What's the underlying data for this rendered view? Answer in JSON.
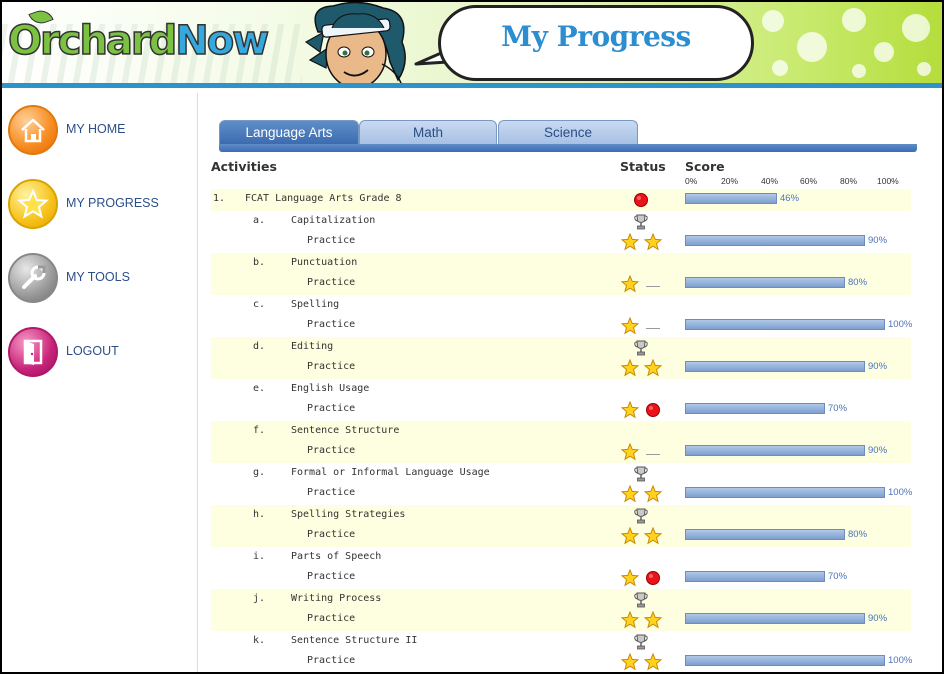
{
  "header": {
    "logo_part1": "Orchard",
    "logo_part2": "Now",
    "page_title": "My Progress"
  },
  "sidebar": {
    "items": [
      {
        "label": "MY HOME",
        "icon": "home-icon",
        "color": "#f78a1d"
      },
      {
        "label": "MY PROGRESS",
        "icon": "star-icon",
        "color": "#f6c21a"
      },
      {
        "label": "MY TOOLS",
        "icon": "wrench-icon",
        "color": "#9a9a9a"
      },
      {
        "label": "LOGOUT",
        "icon": "door-icon",
        "color": "#c8237a"
      }
    ]
  },
  "tabs": [
    {
      "label": "Language Arts",
      "active": true
    },
    {
      "label": "Math",
      "active": false
    },
    {
      "label": "Science",
      "active": false
    }
  ],
  "table": {
    "col_activities": "Activities",
    "col_status": "Status",
    "col_score": "Score",
    "scale": [
      "0%",
      "20%",
      "40%",
      "60%",
      "80%",
      "100%"
    ]
  },
  "course": {
    "num": "1.",
    "title": "FCAT Language Arts Grade 8",
    "status": "red-dot",
    "score": 46,
    "score_label": "46%"
  },
  "units": [
    {
      "letter": "a.",
      "title": "Capitalization",
      "practice": "Practice",
      "trophy": true,
      "status": [
        "star",
        "star"
      ],
      "score": 90,
      "score_label": "90%"
    },
    {
      "letter": "b.",
      "title": "Punctuation",
      "practice": "Practice",
      "trophy": false,
      "status": [
        "star",
        "blank"
      ],
      "score": 80,
      "score_label": "80%"
    },
    {
      "letter": "c.",
      "title": "Spelling",
      "practice": "Practice",
      "trophy": false,
      "status": [
        "star",
        "blank"
      ],
      "score": 100,
      "score_label": "100%"
    },
    {
      "letter": "d.",
      "title": "Editing",
      "practice": "Practice",
      "trophy": true,
      "status": [
        "star",
        "star"
      ],
      "score": 90,
      "score_label": "90%"
    },
    {
      "letter": "e.",
      "title": "English Usage",
      "practice": "Practice",
      "trophy": false,
      "status": [
        "star",
        "red"
      ],
      "score": 70,
      "score_label": "70%"
    },
    {
      "letter": "f.",
      "title": "Sentence Structure",
      "practice": "Practice",
      "trophy": false,
      "status": [
        "star",
        "blank"
      ],
      "score": 90,
      "score_label": "90%"
    },
    {
      "letter": "g.",
      "title": "Formal or Informal Language Usage",
      "practice": "Practice",
      "trophy": true,
      "status": [
        "star",
        "star"
      ],
      "score": 100,
      "score_label": "100%"
    },
    {
      "letter": "h.",
      "title": "Spelling Strategies",
      "practice": "Practice",
      "trophy": true,
      "status": [
        "star",
        "star"
      ],
      "score": 80,
      "score_label": "80%"
    },
    {
      "letter": "i.",
      "title": "Parts of Speech",
      "practice": "Practice",
      "trophy": false,
      "status": [
        "star",
        "red"
      ],
      "score": 70,
      "score_label": "70%"
    },
    {
      "letter": "j.",
      "title": "Writing Process",
      "practice": "Practice",
      "trophy": true,
      "status": [
        "star",
        "star"
      ],
      "score": 90,
      "score_label": "90%"
    },
    {
      "letter": "k.",
      "title": "Sentence Structure II",
      "practice": "Practice",
      "trophy": true,
      "status": [
        "star",
        "star"
      ],
      "score": 100,
      "score_label": "100%"
    }
  ],
  "colors": {
    "accent_blue": "#2c8ed1",
    "row_shade": "#fefee0",
    "bar": "#7e9fcf"
  }
}
